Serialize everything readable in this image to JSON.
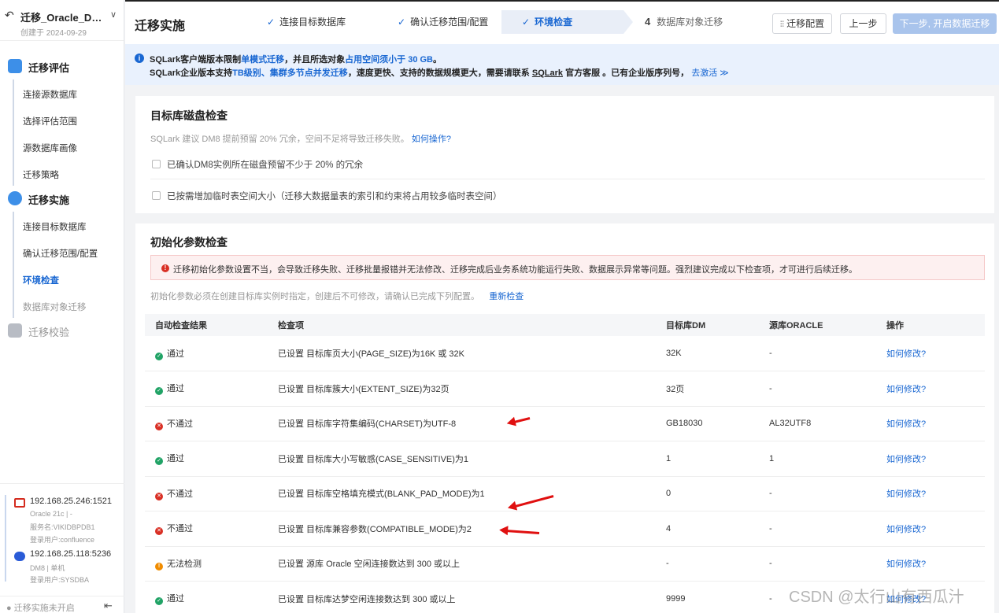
{
  "project": {
    "back_icon": "back-arrow-icon",
    "name": "迁移_Oracle_DM_...",
    "created": "创建于 2024-09-29"
  },
  "sidebar": {
    "group_assess": "迁移评估",
    "assess_items": [
      "连接源数据库",
      "选择评估范围",
      "源数据库画像",
      "迁移策略"
    ],
    "group_impl": "迁移实施",
    "impl_items": [
      "连接目标数据库",
      "确认迁移范围/配置",
      "环境检查",
      "数据库对象迁移"
    ],
    "group_verify": "迁移校验",
    "source_conn": {
      "host": "192.168.25.246:1521",
      "line1": "Oracle 21c | -",
      "line2": "服务名:VIKIDBPDB1",
      "line3": "登录用户:confluence"
    },
    "target_conn": {
      "host": "192.168.25.118:5236",
      "line1": "DM8 | 单机",
      "line2": "登录用户:SYSDBA"
    },
    "footer_status": "● 迁移实施未开启",
    "colors": {
      "assess_icon": "#3d8fe8",
      "impl_icon": "#3d8fe8",
      "verify_icon": "#b8bcc4",
      "oracle": "#d42b1e",
      "dm": "#2a5bd7"
    }
  },
  "header": {
    "title": "迁移实施",
    "steps": [
      "连接目标数据库",
      "确认迁移范围/配置",
      "环境检查",
      "数据库对象迁移"
    ],
    "step4_num": "4",
    "config_btn": "迁移配置",
    "prev_btn": "上一步",
    "next_btn": "下一步, 开启数据迁移"
  },
  "notice": {
    "l1_a": "SQLark客户端版本限制",
    "l1_b": "单模式迁移",
    "l1_c": "，并且所选对象",
    "l1_d": "占用空间须小于 30 GB",
    "l1_e": "。",
    "l2_a": "SQLark企业版本支持",
    "l2_b": "TB级别、集群多节点并发迁移",
    "l2_c": "，速度更快、支持的数据规模更大，需要请联系 ",
    "l2_d": "SQLark",
    "l2_e": " 官方客服 。已有企业版序列号，",
    "l2_f": "去激活 ≫"
  },
  "disk": {
    "title": "目标库磁盘检查",
    "sub": "SQLark 建议 DM8 提前预留 20% 冗余，空间不足将导致迁移失败。",
    "sub_link": "如何操作?",
    "cb1": "已确认DM8实例所在磁盘预留不少于 20% 的冗余",
    "cb2": "已按需增加临时表空间大小（迁移大数据量表的索引和约束将占用较多临时表空间）"
  },
  "init": {
    "title": "初始化参数检查",
    "alert": "迁移初始化参数设置不当，会导致迁移失败、迁移批量报错并无法修改、迁移完成后业务系统功能运行失败、数据展示异常等问题。强烈建议完成以下检查项，才可进行后续迁移。",
    "sub": "初始化参数必须在创建目标库实例时指定，创建后不可修改，请确认已完成下列配置。",
    "recheck": "重新检查",
    "columns": [
      "自动检查结果",
      "检查项",
      "目标库DM",
      "源库ORACLE",
      "操作"
    ],
    "rows": [
      {
        "status": "pass",
        "result": "通过",
        "item": "已设置 目标库页大小(PAGE_SIZE)为16K 或 32K",
        "dm": "32K",
        "oracle": "-",
        "op": "如何修改?"
      },
      {
        "status": "pass",
        "result": "通过",
        "item": "已设置 目标库簇大小(EXTENT_SIZE)为32页",
        "dm": "32页",
        "oracle": "-",
        "op": "如何修改?"
      },
      {
        "status": "fail",
        "result": "不通过",
        "item": "已设置 目标库字符集编码(CHARSET)为UTF-8",
        "dm": "GB18030",
        "oracle": "AL32UTF8",
        "op": "如何修改?"
      },
      {
        "status": "pass",
        "result": "通过",
        "item": "已设置 目标库大小写敏感(CASE_SENSITIVE)为1",
        "dm": "1",
        "oracle": "1",
        "op": "如何修改?"
      },
      {
        "status": "fail",
        "result": "不通过",
        "item": "已设置 目标库空格填充模式(BLANK_PAD_MODE)为1",
        "dm": "0",
        "oracle": "-",
        "op": "如何修改?"
      },
      {
        "status": "fail",
        "result": "不通过",
        "item": "已设置 目标库兼容参数(COMPATIBLE_MODE)为2",
        "dm": "4",
        "oracle": "-",
        "op": "如何修改?"
      },
      {
        "status": "warn",
        "result": "无法检测",
        "item": "已设置 源库 Oracle 空闲连接数达到 300 或以上",
        "dm": "-",
        "oracle": "-",
        "op": "如何修改?"
      },
      {
        "status": "pass",
        "result": "通过",
        "item": "已设置 目标库达梦空闲连接数达到 300 或以上",
        "dm": "9999",
        "oracle": "-",
        "op": "如何修改?"
      }
    ]
  },
  "watermark": "CSDN @太行山有西瓜汁"
}
